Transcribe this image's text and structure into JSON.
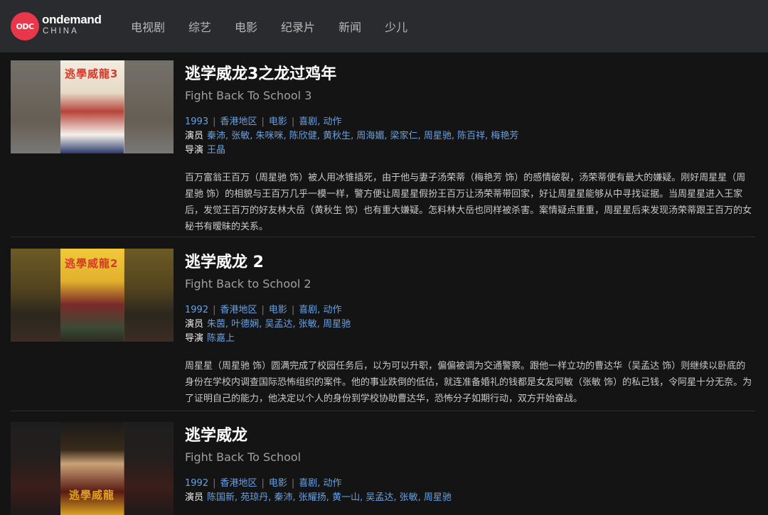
{
  "brand": {
    "badge": "ODC",
    "name": "ondemand",
    "sub": "CHINA"
  },
  "nav": [
    "电视剧",
    "综艺",
    "电影",
    "纪录片",
    "新闻",
    "少儿"
  ],
  "labels": {
    "cast": "演员",
    "director": "导演"
  },
  "items": [
    {
      "title": "逃学威龙3之龙过鸡年",
      "subtitle": "Fight Back To School 3",
      "year": "1993",
      "region": "香港地区",
      "type": "电影",
      "genres": "喜剧, 动作",
      "cast": "秦沛, 张敏, 朱咪咪, 陈欣健, 黄秋生, 周海媚, 梁家仁, 周星驰, 陈百祥, 梅艳芳",
      "director": "王晶",
      "description": "百万富翁王百万（周星驰 饰）被人用冰锥插死，由于他与妻子汤荣蒂（梅艳芳 饰）的感情破裂，汤荣蒂便有最大的嫌疑。刚好周星星（周星驰 饰）的相貌与王百万几乎一模一样，警方便让周星星假扮王百万让汤荣蒂带回家，好让周星星能够从中寻找证据。当周星星进入王家后，发觉王百万的好友林大岳（黄秋生 饰）也有重大嫌疑。怎料林大岳也同样被杀害。案情疑点重重，周星星后来发现汤荣蒂跟王百万的女秘书有暧昧的关系。",
      "poster_text": "逃學威龍3"
    },
    {
      "title": "逃学威龙 2",
      "subtitle": "Fight Back to School 2",
      "year": "1992",
      "region": "香港地区",
      "type": "电影",
      "genres": "喜剧, 动作",
      "cast": "朱茵, 叶德娴, 吴孟达, 张敏, 周星驰",
      "director": "陈嘉上",
      "description": "周星星（周星驰 饰）圆满完成了校园任务后，以为可以升职，偏偏被调为交通警察。跟他一样立功的曹达华（吴孟达 饰）则继续以卧底的身份在学校内调查国际恐怖组织的案件。他的事业跌倒的低估，就连准备婚礼的钱都是女友阿敏（张敏 饰）的私己钱，令阿星十分无奈。为了证明自己的能力，他决定以个人的身份到学校协助曹达华，恐怖分子如期行动，双方开始奋战。",
      "poster_text": "逃學威龍2"
    },
    {
      "title": "逃学威龙",
      "subtitle": "Fight Back To School",
      "year": "1992",
      "region": "香港地区",
      "type": "电影",
      "genres": "喜剧, 动作",
      "cast": "陈国新, 苑琼丹, 秦沛, 张耀扬, 黄一山, 吴孟达, 张敏, 周星驰",
      "poster_text": "逃學威龍"
    }
  ]
}
